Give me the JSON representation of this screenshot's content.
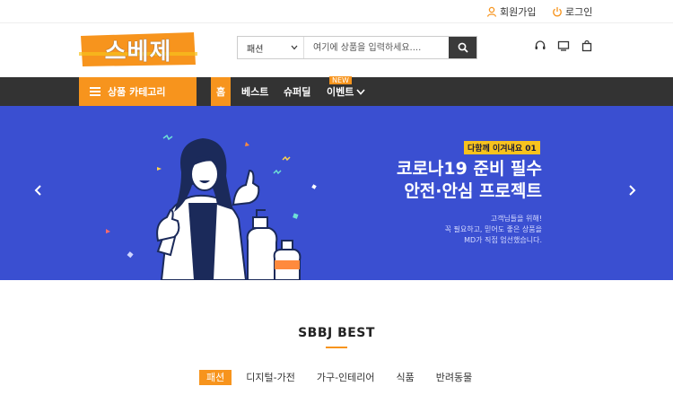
{
  "utility": {
    "signup_label": "회원가입",
    "login_label": "로그인"
  },
  "header": {
    "logo_text": "스베제",
    "search_category": "패션",
    "search_placeholder": "여기에 상품을 입력하세요....",
    "icons": [
      "headset-icon",
      "monitor-icon",
      "cart-icon"
    ]
  },
  "nav": {
    "category_label": "상품 카테고리",
    "items": [
      {
        "label": "홈"
      },
      {
        "label": "베스트"
      },
      {
        "label": "슈퍼딜"
      },
      {
        "label": "이벤트"
      }
    ],
    "new_badge": "NEW"
  },
  "banner": {
    "tag": "다함께 이겨내요 01",
    "title_line1": "코로나19 준비 필수",
    "title_line2": "안전·안심 프로젝트",
    "sub_line1": "고객님들을 위해!",
    "sub_line2": "꼭 필요하고, 믿어도 좋은 상품을",
    "sub_line3": "MD가 직접 엄선했습니다."
  },
  "best": {
    "title": "SBBJ BEST",
    "tabs": [
      {
        "label": "패션"
      },
      {
        "label": "디지털-가전"
      },
      {
        "label": "가구-인테리어"
      },
      {
        "label": "식품"
      },
      {
        "label": "반려동물"
      }
    ]
  },
  "colors": {
    "accent": "#f7941d",
    "nav_bg": "#333333",
    "banner_bg": "#3a4fd1"
  }
}
